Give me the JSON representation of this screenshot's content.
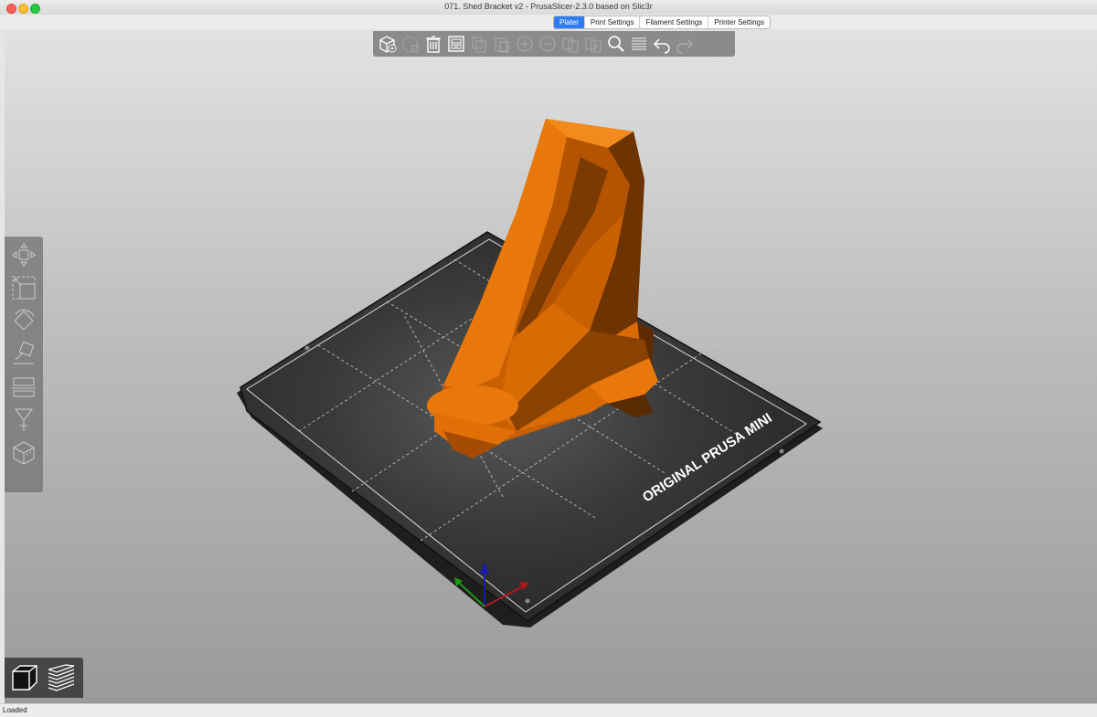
{
  "window": {
    "title": "071. Shed Bracket v2 - PrusaSlicer-2.3.0 based on Slic3r"
  },
  "tabs": [
    {
      "label": "Plater",
      "active": true
    },
    {
      "label": "Print Settings",
      "active": false
    },
    {
      "label": "Filament Settings",
      "active": false
    },
    {
      "label": "Printer Settings",
      "active": false
    }
  ],
  "top_toolbar": [
    {
      "icon": "add-icon",
      "enabled": true
    },
    {
      "icon": "delete-icon",
      "enabled": false
    },
    {
      "icon": "delete-all-icon",
      "enabled": true
    },
    {
      "icon": "arrange-icon",
      "enabled": true
    },
    {
      "icon": "copy-icon",
      "enabled": false
    },
    {
      "icon": "paste-icon",
      "enabled": false
    },
    {
      "icon": "add-instance-icon",
      "enabled": false
    },
    {
      "icon": "remove-instance-icon",
      "enabled": false
    },
    {
      "icon": "split-objects-icon",
      "enabled": false
    },
    {
      "icon": "split-parts-icon",
      "enabled": false
    },
    {
      "icon": "search-icon",
      "enabled": true
    },
    {
      "icon": "layers-editing-icon",
      "enabled": true
    },
    {
      "icon": "undo-icon",
      "enabled": true
    },
    {
      "icon": "redo-icon",
      "enabled": false
    }
  ],
  "side_toolbar": [
    {
      "icon": "move-icon"
    },
    {
      "icon": "scale-icon"
    },
    {
      "icon": "rotate-icon"
    },
    {
      "icon": "place-on-face-icon"
    },
    {
      "icon": "cut-icon"
    },
    {
      "icon": "paint-supports-icon"
    },
    {
      "icon": "seam-painting-icon"
    }
  ],
  "view_buttons": [
    {
      "icon": "3d-view-icon",
      "active": true
    },
    {
      "icon": "preview-icon",
      "active": false
    }
  ],
  "bed": {
    "label": "ORIGINAL PRUSA MINI"
  },
  "colors": {
    "model": "#e87a0c",
    "bed": "#2c2c2c",
    "accent": "#2f7df6"
  },
  "status": {
    "text": "Loaded"
  }
}
